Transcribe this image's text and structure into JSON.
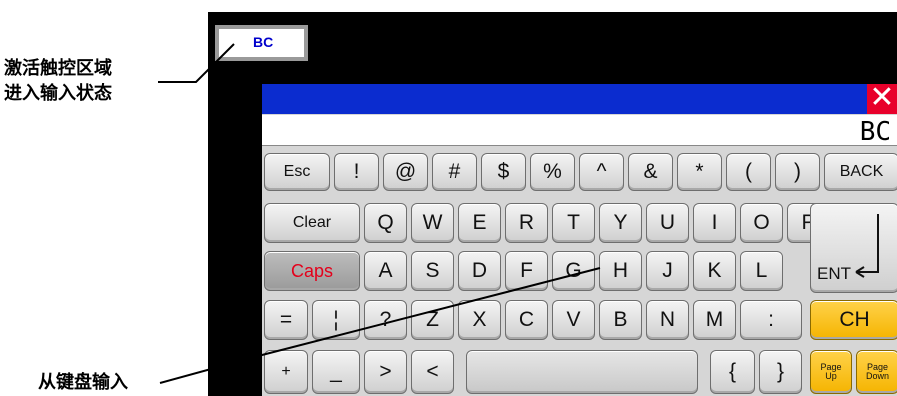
{
  "input_box": {
    "value": "BC"
  },
  "callouts": {
    "activate_line1": "激活触控区域",
    "activate_line2": "进入输入状态",
    "keyboard_input": "从键盘输入"
  },
  "keyboard": {
    "display_value": "BC",
    "close_symbol": "✕",
    "keys": {
      "esc": "Esc",
      "exclaim": "!",
      "at": "@",
      "hash": "#",
      "dollar": "$",
      "percent": "%",
      "caret": "^",
      "amp": "&",
      "star": "*",
      "lparen": "(",
      "rparen": ")",
      "back": "BACK",
      "clear": "Clear",
      "q": "Q",
      "w": "W",
      "e": "E",
      "r": "R",
      "t": "T",
      "y": "Y",
      "u": "U",
      "i": "I",
      "o": "O",
      "p": "P",
      "caps": "Caps",
      "a": "A",
      "s": "S",
      "d": "D",
      "f": "F",
      "g": "G",
      "h": "H",
      "j": "J",
      "k": "K",
      "l": "L",
      "ent": "ENT",
      "equals": "=",
      "pipe": "¦",
      "question": "?",
      "z": "Z",
      "x": "X",
      "c": "C",
      "v": "V",
      "b": "B",
      "n": "N",
      "m": "M",
      "colon": ":",
      "ch": "CH",
      "plus": "+",
      "underscore": "_",
      "gt": ">",
      "lt": "<",
      "lbrace": "{",
      "rbrace": "}",
      "pageup_1": "Page",
      "pageup_2": "Up",
      "pagedown_1": "Page",
      "pagedown_2": "Down"
    }
  },
  "colors": {
    "title_bar": "#0b2ccf",
    "close": "#e8002b",
    "accent_keys": "#f5b400",
    "caps_text": "#e4001b"
  }
}
